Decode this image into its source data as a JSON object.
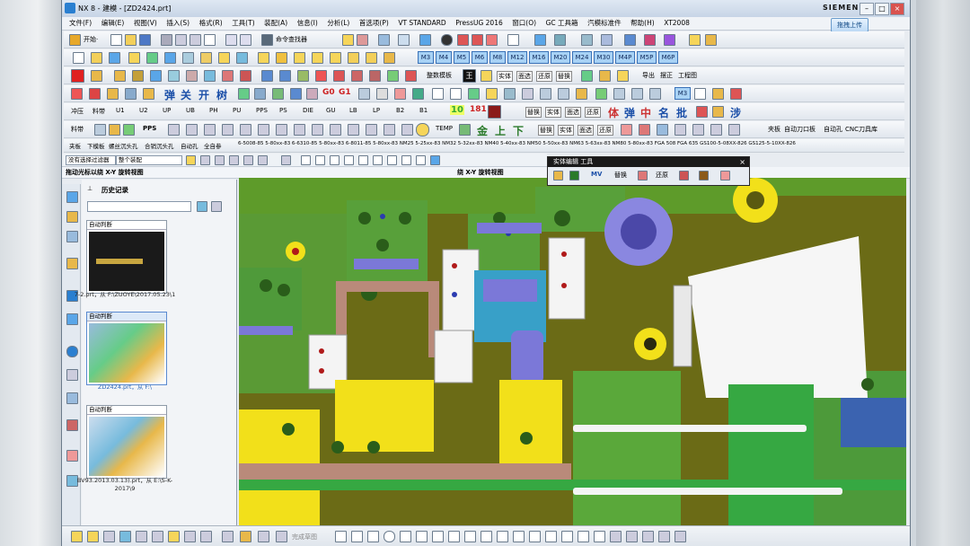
{
  "window": {
    "title": "NX 8 - 建模 - [ZD2424.prt]",
    "brand": "SIEMENS",
    "cloud_button": "拖拽上传",
    "controls": [
      "–",
      "□",
      "×"
    ]
  },
  "menu": [
    "文件(F)",
    "编辑(E)",
    "视图(V)",
    "插入(S)",
    "格式(R)",
    "工具(T)",
    "装配(A)",
    "信息(I)",
    "分析(L)",
    "首选项(P)",
    "VT STANDARD",
    "PressUG 2016",
    "窗口(O)",
    "GC 工具箱",
    "汽模标准件",
    "帮助(H)",
    "XT2008"
  ],
  "toolbar1": {
    "start_label": "开始·",
    "command_finder": "命令查找器"
  },
  "toolbar2": {
    "tabs": [
      "M3",
      "M4",
      "M5",
      "M6",
      "M8",
      "M12",
      "M16",
      "M20",
      "M24",
      "M30",
      "M4P",
      "M5P",
      "M6P"
    ]
  },
  "toolbar3": {
    "labels": [
      "整数模板",
      "王",
      "实体",
      "面选",
      "还原",
      "替换",
      "导出",
      "摆正",
      "工程图"
    ]
  },
  "toolbar4": {
    "big": [
      "弹",
      "关",
      "开",
      "树",
      "G0",
      "G1"
    ],
    "tab": "M3"
  },
  "toolbar5": {
    "labels": [
      "冲压",
      "料带",
      "U1",
      "U2",
      "UP",
      "UB",
      "PH",
      "PU",
      "PPS",
      "PS",
      "DIE",
      "GU",
      "LB",
      "LP",
      "B2",
      "B1",
      "10",
      "181",
      "替换",
      "实体",
      "面选",
      "还原"
    ],
    "big": [
      "体",
      "弹",
      "中",
      "名",
      "批",
      "涉"
    ]
  },
  "toolbar6": {
    "labels": [
      "料带",
      "PPS",
      "TEMP",
      "金",
      "上",
      "下",
      "替换",
      "实体",
      "面选",
      "还原",
      "夹板",
      "自动刀口板",
      "自动孔",
      "CNC刀具库"
    ]
  },
  "toolbar7": {
    "items": [
      "夹板",
      "下模板",
      "螺丝沉头孔",
      "合销沉头孔",
      "自动孔",
      "全自参",
      "6-5008-85 5-80xx-83 6-6310-85 5-80xx-83 6-8011-85 5-80xx-83 NM25 5-25xx-83 NM32 5-32xx-83 NM40 5-40xx-83 NM50 5-50xx-83 NM63 5-63xx-83 NM80 5-80xx-83 FGA 508 FGA 635 GS100-5-08XX-826 GS125-5-10XX-826"
    ]
  },
  "selection_bar": {
    "filter": "没有选择过滤器",
    "assembly": "整个装配"
  },
  "view_header": {
    "left": "拖动光标以绕 X-Y 旋转视图",
    "right": "绕 X-Y 旋转视图"
  },
  "float_toolbar": {
    "title": "实体编辑 工具",
    "labels": [
      "MV",
      "替换",
      "还原"
    ]
  },
  "history": {
    "title": "历史记录",
    "items": [
      {
        "dropdown": "自动判断",
        "caption": "7-2.prt，从 F:\\ZUOYE\\2017.05.23\\1"
      },
      {
        "dropdown": "自动判断",
        "caption": "ZD2424.prt，从 F:\\"
      },
      {
        "dropdown": "自动判断",
        "caption": "BV93.2013.03.13).prt，从 E:\\S-K-2017\\9"
      }
    ]
  },
  "bottom_bar": {
    "label": "完成草图"
  },
  "colors": {
    "model_olive": "#6b6b16",
    "yellow": "#f2e01a",
    "green": "#2fa13a",
    "purple": "#7b78d8",
    "brown": "#b98a7a",
    "white": "#f4f4f4",
    "blue": "#3b63b0"
  }
}
